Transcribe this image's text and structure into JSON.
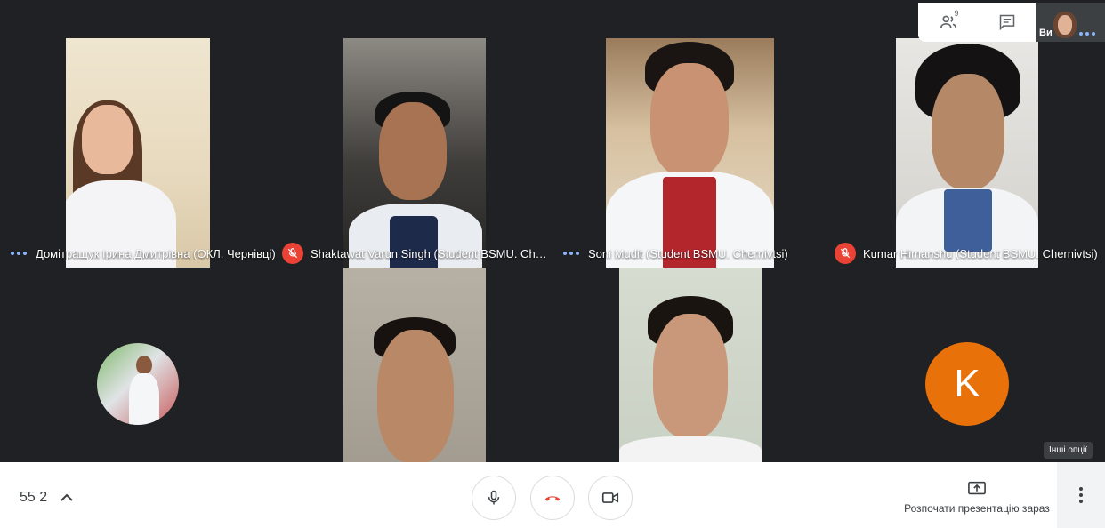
{
  "top_panel": {
    "participants_count": "9",
    "self_label": "Ви"
  },
  "tiles": [
    {
      "name": "Домітращук Ірина Дмитрівна (ОКЛ. Чернівці)",
      "status": "speaking-dots"
    },
    {
      "name": "Shaktawat Varun Singh (Student BSMU. Chern…",
      "status": "muted"
    },
    {
      "name": "Soni Mudit (Student BSMU. Chernivtsi)",
      "status": "speaking-dots"
    },
    {
      "name": "Kumar Himanshu (Student BSMU. Chernivtsi)",
      "status": "muted"
    },
    {
      "name": "",
      "status": "photo-avatar"
    },
    {
      "name": "",
      "status": "video"
    },
    {
      "name": "",
      "status": "video"
    },
    {
      "name": "",
      "avatar_letter": "K",
      "status": "letter-avatar"
    }
  ],
  "bottom_bar": {
    "meeting_code": "55 2",
    "present_label": "Розпочати презентацію зараз",
    "tooltip": "Інші опції"
  },
  "colors": {
    "background": "#202124",
    "accent_blue": "#8ab4f8",
    "end_call_red": "#ea4335",
    "avatar_orange": "#e8710a"
  }
}
